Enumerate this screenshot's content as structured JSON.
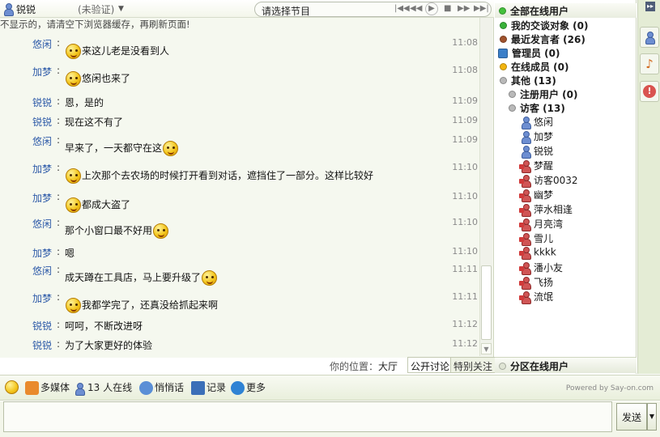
{
  "header": {
    "username": "锐锐",
    "status": "(未验证)",
    "program_placeholder": "请选择节目"
  },
  "notice": "不显示的，请清空下浏览器缓存，再刷新页面!",
  "messages": [
    {
      "sender": "悠闲",
      "text": "来这儿老是没看到人",
      "time": "11:08",
      "emoji": "before"
    },
    {
      "sender": "加梦",
      "text": "悠闲也来了",
      "time": "11:08",
      "emoji": "before"
    },
    {
      "sender": "锐锐",
      "text": "恩，是的",
      "time": "11:09",
      "emoji": "none"
    },
    {
      "sender": "锐锐",
      "text": "现在这不有了",
      "time": "11:09",
      "emoji": "none"
    },
    {
      "sender": "悠闲",
      "text": "早来了，一天都守在这",
      "time": "11:09",
      "emoji": "after"
    },
    {
      "sender": "加梦",
      "text": "上次那个去农场的时候打开看到对话，遮挡住了一部分。这样比较好",
      "time": "11:10",
      "emoji": "before"
    },
    {
      "sender": "加梦",
      "text": "都成大盗了",
      "time": "11:10",
      "emoji": "before"
    },
    {
      "sender": "悠闲",
      "text": "那个小窗口最不好用",
      "time": "11:10",
      "emoji": "after"
    },
    {
      "sender": "加梦",
      "text": "嗯",
      "time": "11:10",
      "emoji": "none"
    },
    {
      "sender": "悠闲",
      "text": "成天蹲在工具店，马上要升级了",
      "time": "11:11",
      "emoji": "after"
    },
    {
      "sender": "加梦",
      "text": "我都学完了，还真没给抓起来啊",
      "time": "11:11",
      "emoji": "before"
    },
    {
      "sender": "锐锐",
      "text": "呵呵，不断改进呀",
      "time": "11:12",
      "emoji": "none"
    },
    {
      "sender": "锐锐",
      "text": "为了大家更好的体验",
      "time": "11:12",
      "emoji": "none"
    }
  ],
  "location_label": "你的位置：",
  "location_value": "大厅",
  "tabs": {
    "public": "公开讨论",
    "special": "特别关注"
  },
  "sidebar": {
    "header": "全部在线用户",
    "my_chat": "我的交谈对象 (0)",
    "recent": "最近发言者 (26)",
    "admin": "管理员 (0)",
    "online_members": "在线成员 (0)",
    "other": "其他 (13)",
    "registered": "注册用户 (0)",
    "visitors": "访客 (13)",
    "users": [
      "悠闲",
      "加梦",
      "锐锐",
      "梦醒",
      "访客0032",
      "幽梦",
      "萍水相逢",
      "月亮湾",
      "雪儿",
      "kkkk",
      "潘小友",
      "飞扬",
      "流氓"
    ],
    "footer": "分区在线用户"
  },
  "toolbar": {
    "multimedia": "多媒体",
    "online_count": "13 人在线",
    "whisper": "悄悄话",
    "record": "记录",
    "more": "更多",
    "powered": "Powered by Say-on.com"
  },
  "send_label": "发送"
}
